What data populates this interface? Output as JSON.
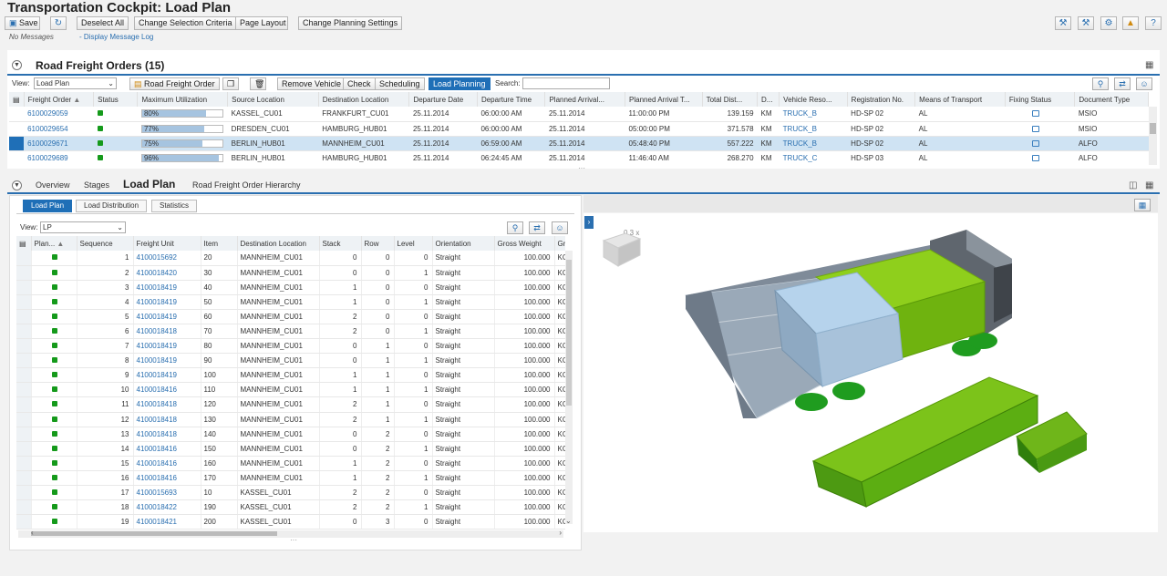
{
  "app": {
    "title": "Transportation Cockpit: Load Plan"
  },
  "toolbar": {
    "save": "Save",
    "deselect_all": "Deselect All",
    "change_selection": "Change Selection Criteria",
    "page_layout": "Page Layout",
    "change_planning": "Change Planning Settings"
  },
  "messages": {
    "status": "No Messages",
    "log_link": "Display Message Log"
  },
  "rfo": {
    "title": "Road Freight Orders (15)",
    "view_label": "View:",
    "view_value": "Load Plan",
    "buttons": {
      "road_freight_order": "Road Freight Order",
      "remove_vehicle": "Remove Vehicle",
      "check": "Check",
      "scheduling": "Scheduling",
      "load_planning": "Load Planning"
    },
    "search_label": "Search:",
    "columns": [
      "Freight Order",
      "Status",
      "Maximum Utilization",
      "Source Location",
      "Destination Location",
      "Departure Date",
      "Departure Time",
      "Planned Arrival...",
      "Planned Arrival T...",
      "Total Dist...",
      "D...",
      "Vehicle Reso...",
      "Registration No.",
      "Means of Transport",
      "Fixing Status",
      "Document Type"
    ],
    "rows": [
      {
        "order": "6100029059",
        "util": "80%",
        "util_pct": 80,
        "src": "KASSEL_CU01",
        "dst": "FRANKFURT_CU01",
        "dep_date": "25.11.2014",
        "dep_time": "06:00:00 AM",
        "arr_date": "25.11.2014",
        "arr_time": "11:00:00 PM",
        "dist": "139.159",
        "unit": "KM",
        "vehicle": "TRUCK_B",
        "reg": "HD-SP 02",
        "means": "AL",
        "doc": "MSIO"
      },
      {
        "order": "6100029654",
        "util": "77%",
        "util_pct": 77,
        "src": "DRESDEN_CU01",
        "dst": "HAMBURG_HUB01",
        "dep_date": "25.11.2014",
        "dep_time": "06:00:00 AM",
        "arr_date": "25.11.2014",
        "arr_time": "05:00:00 PM",
        "dist": "371.578",
        "unit": "KM",
        "vehicle": "TRUCK_B",
        "reg": "HD-SP 02",
        "means": "AL",
        "doc": "MSIO"
      },
      {
        "order": "6100029671",
        "util": "75%",
        "util_pct": 75,
        "src": "BERLIN_HUB01",
        "dst": "MANNHEIM_CU01",
        "dep_date": "25.11.2014",
        "dep_time": "06:59:00 AM",
        "arr_date": "25.11.2014",
        "arr_time": "05:48:40 PM",
        "dist": "557.222",
        "unit": "KM",
        "vehicle": "TRUCK_B",
        "reg": "HD-SP 02",
        "means": "AL",
        "doc": "ALFO"
      },
      {
        "order": "6100029689",
        "util": "96%",
        "util_pct": 96,
        "src": "BERLIN_HUB01",
        "dst": "HAMBURG_HUB01",
        "dep_date": "25.11.2014",
        "dep_time": "06:24:45 AM",
        "arr_date": "25.11.2014",
        "arr_time": "11:46:40 AM",
        "dist": "268.270",
        "unit": "KM",
        "vehicle": "TRUCK_C",
        "reg": "HD-SP 03",
        "means": "AL",
        "doc": "ALFO"
      }
    ]
  },
  "tabs": {
    "overview": "Overview",
    "stages": "Stages",
    "load_plan": "Load Plan",
    "hierarchy": "Road Freight Order Hierarchy"
  },
  "lp": {
    "subtabs": {
      "load_plan": "Load Plan",
      "load_distribution": "Load Distribution",
      "statistics": "Statistics"
    },
    "view_label": "View:",
    "view_value": "LP",
    "columns": [
      "Plan...",
      "Sequence",
      "Freight Unit",
      "Item",
      "Destination Location",
      "Stack",
      "Row",
      "Level",
      "Orientation",
      "Gross Weight",
      "Gro"
    ],
    "rows": [
      {
        "seq": "1",
        "fu": "4100015692",
        "item": "20",
        "dst": "MANNHEIM_CU01",
        "stack": "0",
        "row": "0",
        "level": "0",
        "orient": "Straight",
        "gw": "100.000",
        "u": "KG"
      },
      {
        "seq": "2",
        "fu": "4100018420",
        "item": "30",
        "dst": "MANNHEIM_CU01",
        "stack": "0",
        "row": "0",
        "level": "1",
        "orient": "Straight",
        "gw": "100.000",
        "u": "KG"
      },
      {
        "seq": "3",
        "fu": "4100018419",
        "item": "40",
        "dst": "MANNHEIM_CU01",
        "stack": "1",
        "row": "0",
        "level": "0",
        "orient": "Straight",
        "gw": "100.000",
        "u": "KG"
      },
      {
        "seq": "4",
        "fu": "4100018419",
        "item": "50",
        "dst": "MANNHEIM_CU01",
        "stack": "1",
        "row": "0",
        "level": "1",
        "orient": "Straight",
        "gw": "100.000",
        "u": "KG"
      },
      {
        "seq": "5",
        "fu": "4100018419",
        "item": "60",
        "dst": "MANNHEIM_CU01",
        "stack": "2",
        "row": "0",
        "level": "0",
        "orient": "Straight",
        "gw": "100.000",
        "u": "KG"
      },
      {
        "seq": "6",
        "fu": "4100018418",
        "item": "70",
        "dst": "MANNHEIM_CU01",
        "stack": "2",
        "row": "0",
        "level": "1",
        "orient": "Straight",
        "gw": "100.000",
        "u": "KG"
      },
      {
        "seq": "7",
        "fu": "4100018419",
        "item": "80",
        "dst": "MANNHEIM_CU01",
        "stack": "0",
        "row": "1",
        "level": "0",
        "orient": "Straight",
        "gw": "100.000",
        "u": "KG"
      },
      {
        "seq": "8",
        "fu": "4100018419",
        "item": "90",
        "dst": "MANNHEIM_CU01",
        "stack": "0",
        "row": "1",
        "level": "1",
        "orient": "Straight",
        "gw": "100.000",
        "u": "KG"
      },
      {
        "seq": "9",
        "fu": "4100018419",
        "item": "100",
        "dst": "MANNHEIM_CU01",
        "stack": "1",
        "row": "1",
        "level": "0",
        "orient": "Straight",
        "gw": "100.000",
        "u": "KG"
      },
      {
        "seq": "10",
        "fu": "4100018416",
        "item": "110",
        "dst": "MANNHEIM_CU01",
        "stack": "1",
        "row": "1",
        "level": "1",
        "orient": "Straight",
        "gw": "100.000",
        "u": "KG"
      },
      {
        "seq": "11",
        "fu": "4100018418",
        "item": "120",
        "dst": "MANNHEIM_CU01",
        "stack": "2",
        "row": "1",
        "level": "0",
        "orient": "Straight",
        "gw": "100.000",
        "u": "KG"
      },
      {
        "seq": "12",
        "fu": "4100018418",
        "item": "130",
        "dst": "MANNHEIM_CU01",
        "stack": "2",
        "row": "1",
        "level": "1",
        "orient": "Straight",
        "gw": "100.000",
        "u": "KG"
      },
      {
        "seq": "13",
        "fu": "4100018418",
        "item": "140",
        "dst": "MANNHEIM_CU01",
        "stack": "0",
        "row": "2",
        "level": "0",
        "orient": "Straight",
        "gw": "100.000",
        "u": "KG"
      },
      {
        "seq": "14",
        "fu": "4100018416",
        "item": "150",
        "dst": "MANNHEIM_CU01",
        "stack": "0",
        "row": "2",
        "level": "1",
        "orient": "Straight",
        "gw": "100.000",
        "u": "KG"
      },
      {
        "seq": "15",
        "fu": "4100018416",
        "item": "160",
        "dst": "MANNHEIM_CU01",
        "stack": "1",
        "row": "2",
        "level": "0",
        "orient": "Straight",
        "gw": "100.000",
        "u": "KG"
      },
      {
        "seq": "16",
        "fu": "4100018416",
        "item": "170",
        "dst": "MANNHEIM_CU01",
        "stack": "1",
        "row": "2",
        "level": "1",
        "orient": "Straight",
        "gw": "100.000",
        "u": "KG"
      },
      {
        "seq": "17",
        "fu": "4100015693",
        "item": "10",
        "dst": "KASSEL_CU01",
        "stack": "2",
        "row": "2",
        "level": "0",
        "orient": "Straight",
        "gw": "100.000",
        "u": "KG"
      },
      {
        "seq": "18",
        "fu": "4100018422",
        "item": "190",
        "dst": "KASSEL_CU01",
        "stack": "2",
        "row": "2",
        "level": "1",
        "orient": "Straight",
        "gw": "100.000",
        "u": "KG"
      },
      {
        "seq": "19",
        "fu": "4100018421",
        "item": "200",
        "dst": "KASSEL_CU01",
        "stack": "0",
        "row": "3",
        "level": "0",
        "orient": "Straight",
        "gw": "100.000",
        "u": "KG"
      }
    ]
  },
  "viewer": {
    "zoom": "0.3 x"
  },
  "colors": {
    "accent": "#1f6fb7",
    "status_green": "#159a1b",
    "cargo_green": "#7fc51a",
    "cargo_blue": "#a9c9e6"
  }
}
